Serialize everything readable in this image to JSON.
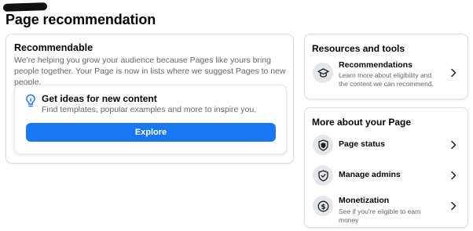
{
  "page": {
    "title": "Page recommendation"
  },
  "main": {
    "heading": "Recommendable",
    "description": "We're helping you grow your audience because Pages like yours bring people together. Your Page is now in lists where we suggest Pages to new people.",
    "ideas": {
      "icon": "lightbulb-icon",
      "title": "Get ideas for new content",
      "description": "Find templates, popular examples and more to inspire you.",
      "button_label": "Explore"
    }
  },
  "resources": {
    "heading": "Resources and tools",
    "items": [
      {
        "icon": "graduation-cap-icon",
        "title": "Recommendations",
        "description": "Learn more about eligibility and the content we can recommend."
      }
    ]
  },
  "more": {
    "heading": "More about your Page",
    "items": [
      {
        "icon": "shield-icon",
        "title": "Page status"
      },
      {
        "icon": "shield-check-icon",
        "title": "Manage admins"
      },
      {
        "icon": "dollar-icon",
        "title": "Monetization",
        "description": "See if you're eligible to earn money"
      }
    ]
  },
  "colors": {
    "accent": "#1877f2",
    "text": "#050505",
    "muted": "#65676b",
    "icon_bg": "#e4e6eb"
  }
}
